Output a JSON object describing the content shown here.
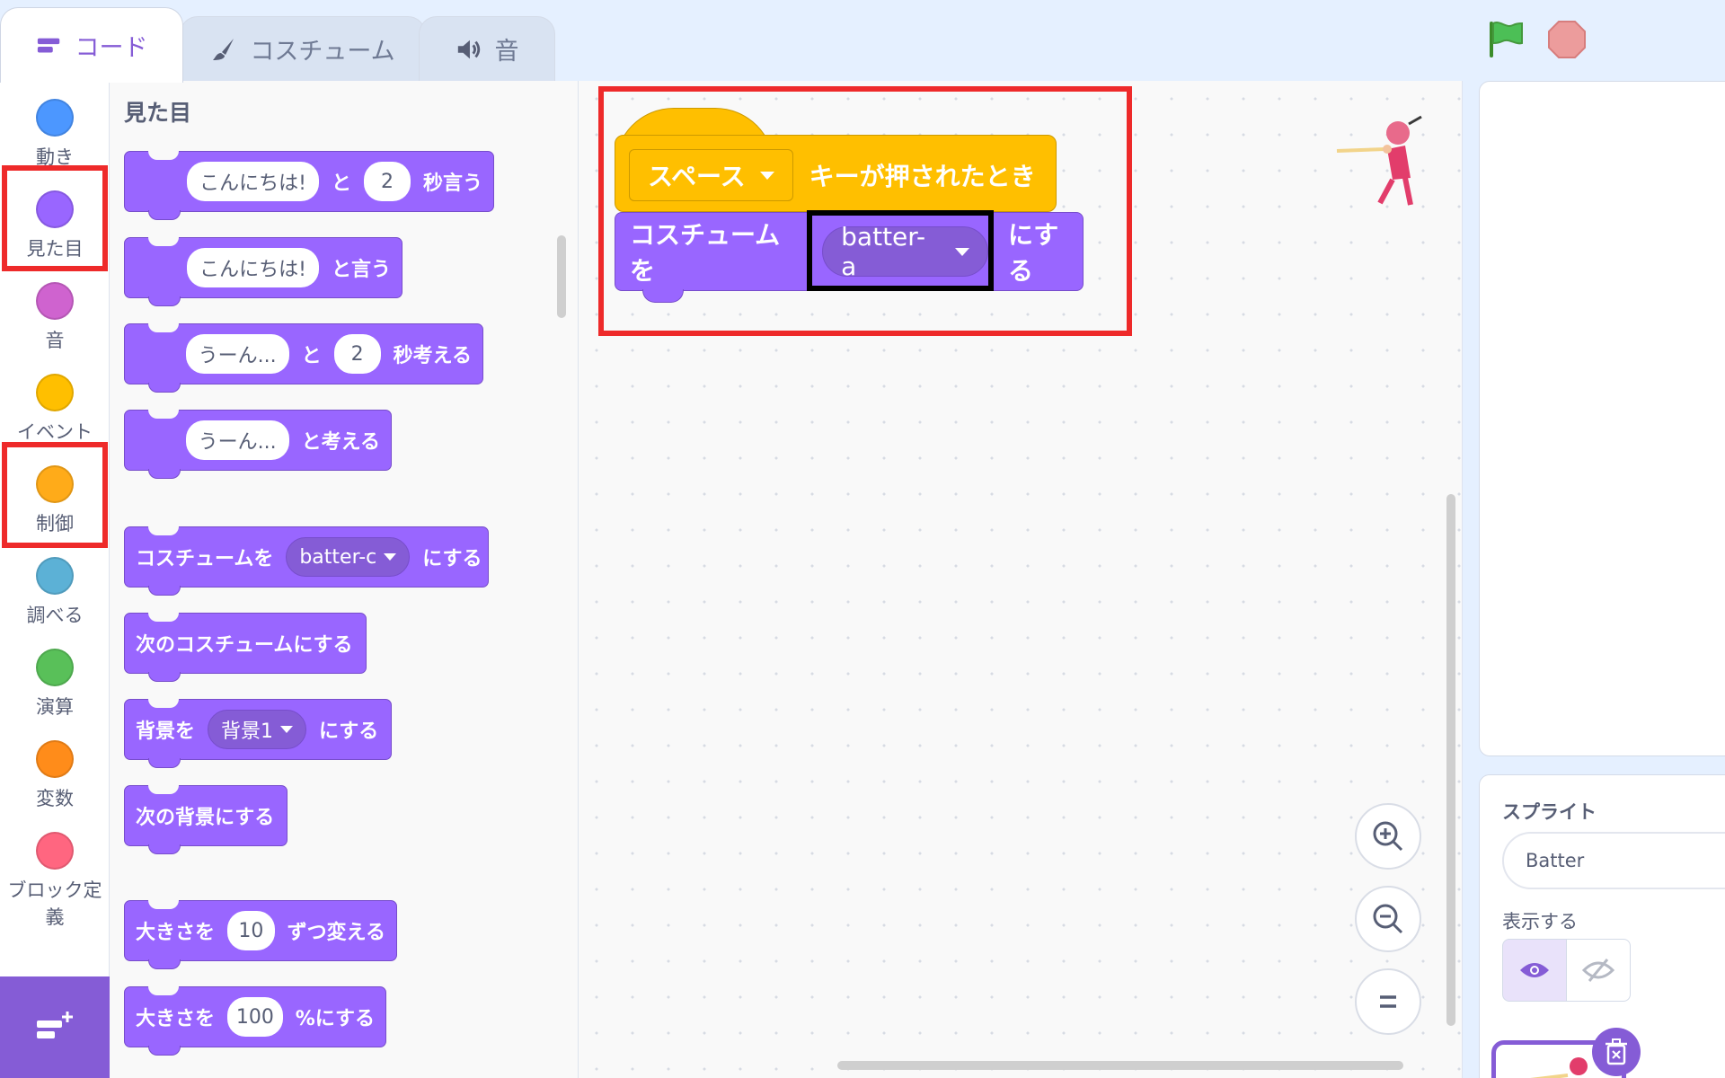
{
  "tabs": [
    {
      "label": "コード",
      "icon": "code-blocks-icon",
      "active": true
    },
    {
      "label": "コスチューム",
      "icon": "paintbrush-icon",
      "active": false
    },
    {
      "label": "音",
      "icon": "speaker-icon",
      "active": false
    }
  ],
  "categories": [
    {
      "label": "動き",
      "color": "#4c97ff"
    },
    {
      "label": "見た目",
      "color": "#9966ff"
    },
    {
      "label": "音",
      "color": "#cf63cf"
    },
    {
      "label": "イベント",
      "color": "#ffbf00"
    },
    {
      "label": "制御",
      "color": "#ffab19"
    },
    {
      "label": "調べる",
      "color": "#5cb1d6"
    },
    {
      "label": "演算",
      "color": "#59c059"
    },
    {
      "label": "変数",
      "color": "#ff8c1a"
    },
    {
      "label": "ブロック定義",
      "color": "#ff6680"
    }
  ],
  "palette": {
    "title": "見た目",
    "say_secs": {
      "msg": "こんにちは!",
      "and": "と",
      "secs": "2",
      "suffix": "秒言う"
    },
    "say": {
      "msg": "こんにちは!",
      "suffix": "と言う"
    },
    "think_secs": {
      "msg": "うーん...",
      "and": "と",
      "secs": "2",
      "suffix": "秒考える"
    },
    "think": {
      "msg": "うーん...",
      "suffix": "と考える"
    },
    "switch_costume": {
      "prefix": "コスチュームを",
      "value": "batter-c",
      "suffix": "にする"
    },
    "next_costume": {
      "label": "次のコスチュームにする"
    },
    "switch_backdrop": {
      "prefix": "背景を",
      "value": "背景1",
      "suffix": "にする"
    },
    "next_backdrop": {
      "label": "次の背景にする"
    },
    "change_size": {
      "prefix": "大きさを",
      "value": "10",
      "suffix": "ずつ変える"
    },
    "set_size": {
      "prefix": "大きさを",
      "value": "100",
      "suffix": "%にする"
    }
  },
  "script": {
    "hat": {
      "key": "スペース",
      "suffix": "キーが押されたとき"
    },
    "costume": {
      "prefix": "コスチュームを",
      "value": "batter-a",
      "suffix": "にする"
    }
  },
  "sprite_panel": {
    "sprite_label": "スプライト",
    "sprite_name": "Batter",
    "show_label": "表示する"
  },
  "colors": {
    "looks": "#9966ff",
    "events": "#ffbf00",
    "accent": "#855cd6",
    "highlight_red": "#ee2a2a",
    "highlight_black": "#000000"
  }
}
